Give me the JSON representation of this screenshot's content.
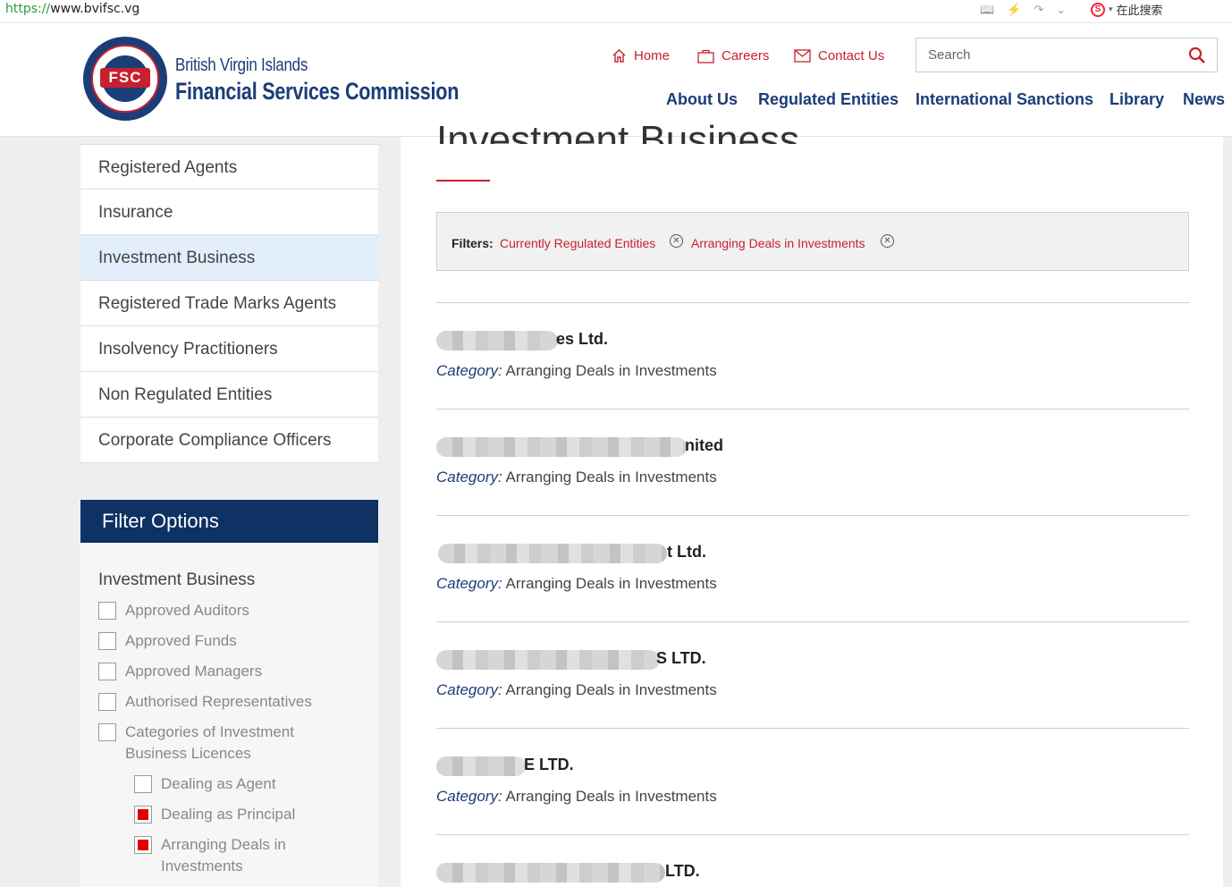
{
  "browser": {
    "url_protocol": "https://",
    "url_host": "www.bvifsc.vg",
    "search_label": "在此搜索"
  },
  "header": {
    "logo_line1": "British Virgin Islands",
    "logo_line2": "Financial Services Commission",
    "logo_seal_text": "FSC",
    "util_links": [
      "Home",
      "Careers",
      "Contact Us"
    ],
    "search_placeholder": "Search",
    "main_nav": [
      "About Us",
      "Regulated Entities",
      "International Sanctions",
      "Library",
      "News"
    ]
  },
  "sidebar": {
    "items": [
      {
        "label": "Registered Agents",
        "active": false
      },
      {
        "label": "Insurance",
        "active": false
      },
      {
        "label": "Investment Business",
        "active": true
      },
      {
        "label": "Registered Trade Marks Agents",
        "active": false
      },
      {
        "label": "Insolvency Practitioners",
        "active": false
      },
      {
        "label": "Non Regulated Entities",
        "active": false
      },
      {
        "label": "Corporate Compliance Officers",
        "active": false
      }
    ],
    "filter_heading": "Filter Options",
    "filter_group_title": "Investment Business",
    "options": [
      {
        "label": "Approved Auditors",
        "checked": false
      },
      {
        "label": "Approved Funds",
        "checked": false
      },
      {
        "label": "Approved Managers",
        "checked": false
      },
      {
        "label": "Authorised Representatives",
        "checked": false
      },
      {
        "label_line1": "Categories of Investment",
        "label_line2": "Business Licences",
        "checked": false
      },
      {
        "label": "Dealing as Agent",
        "checked": false
      },
      {
        "label": "Dealing as Principal",
        "checked": true
      },
      {
        "label_line1": "Arranging Deals in",
        "label_line2": "Investments",
        "checked": true
      }
    ]
  },
  "main": {
    "page_title": "Investment Business",
    "filters_label": "Filters:",
    "active_filters": [
      "Currently Regulated Entities",
      "Arranging Deals in Investments"
    ],
    "category_label": "Category:",
    "results": [
      {
        "name_visible": "es Ltd.",
        "category": "Arranging Deals in Investments"
      },
      {
        "name_visible": "nited",
        "category": "Arranging Deals in Investments"
      },
      {
        "name_visible": "t Ltd.",
        "category": "Arranging Deals in Investments"
      },
      {
        "name_visible": "S LTD.",
        "category": "Arranging Deals in Investments"
      },
      {
        "name_visible": "E LTD.",
        "category": "Arranging Deals in Investments"
      },
      {
        "name_visible": "LTD.",
        "category": ""
      }
    ]
  },
  "colors": {
    "brand_navy": "#1b3d78",
    "brand_red": "#c8202f",
    "filter_header_bg": "#0d3263",
    "active_sidebar_bg": "#e2eef9",
    "checkbox_checked": "#e00000"
  }
}
